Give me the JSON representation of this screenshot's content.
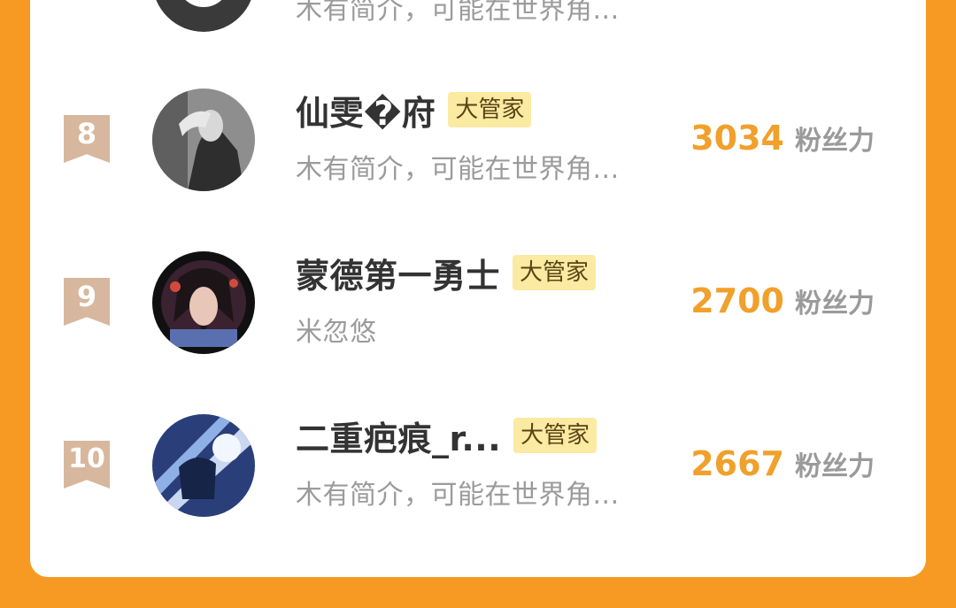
{
  "partial_top": {
    "bio": "木有简介，可能在世界角..."
  },
  "rows": [
    {
      "rank": "8",
      "name": "仙雯�府",
      "badge": "大管家",
      "bio": "木有简介，可能在世界角...",
      "score": "3034",
      "unit": "粉丝力"
    },
    {
      "rank": "9",
      "name": "蒙德第一勇士",
      "badge": "大管家",
      "bio": "米忽悠",
      "score": "2700",
      "unit": "粉丝力"
    },
    {
      "rank": "10",
      "name": "二重疤痕_r...",
      "badge": "大管家",
      "bio": "木有简介，可能在世界角...",
      "score": "2667",
      "unit": "粉丝力"
    }
  ],
  "colors": {
    "background": "#f79a24",
    "score": "#f0a02b",
    "badge_bg": "#fbeaa1",
    "rank_ribbon": "#d7b79d"
  }
}
